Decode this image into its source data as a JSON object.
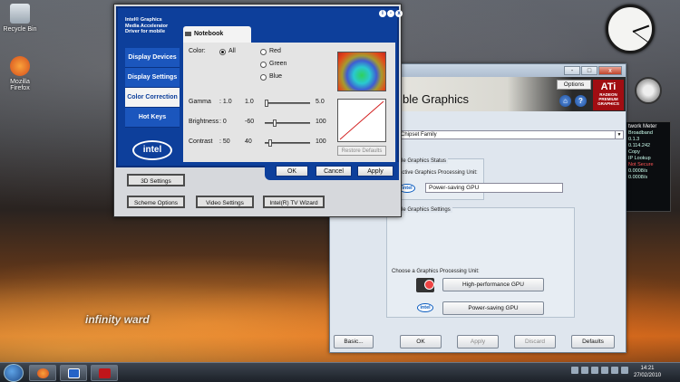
{
  "desktop": {
    "icons": [
      {
        "name": "recycle-bin",
        "label": "Recycle Bin"
      },
      {
        "name": "firefox",
        "label": "Mozilla Firefox"
      }
    ],
    "wallpaper_logo": "infinity ward"
  },
  "intel_window": {
    "brand": "Intel® Graphics Media Accelerator Driver for mobile",
    "title_buttons": [
      "i",
      "-",
      "x"
    ],
    "nav": [
      "Display Devices",
      "Display Settings",
      "Color Correction",
      "Hot Keys"
    ],
    "active_nav": "Color Correction",
    "logo": "intel",
    "tab": "Notebook",
    "color_label": "Color:",
    "color_options": [
      "All",
      "Red",
      "Green",
      "Blue"
    ],
    "selected_color": "All",
    "sliders": [
      {
        "label": "Gamma",
        "min": ": 1.0",
        "value": "1.0",
        "max": "5.0",
        "fraction": 0.0
      },
      {
        "label": "Brightness",
        "min": ": 0",
        "value": "-60",
        "max": "100",
        "fraction": 0.2
      },
      {
        "label": "Contrast",
        "min": ": 50",
        "value": "40",
        "max": "100",
        "fraction": 0.1
      }
    ],
    "restore": "Restore Defaults",
    "ok": "OK",
    "cancel": "Cancel",
    "apply": "Apply",
    "extra_buttons": [
      "3D Settings",
      "Scheme Options",
      "Video Settings",
      "Intel(R) TV Wizard"
    ]
  },
  "ati_window": {
    "title_fragment": "ter",
    "window_controls": [
      "-",
      "□",
      "x"
    ],
    "options": "Options",
    "heading": "ble Graphics",
    "logo_main": "ATi",
    "logo_sub": "RADEON PREMIUM GRAPHICS",
    "chipset": "ress Chipset Family",
    "status_group": "itchable Graphics Status",
    "current_label": "rrent active Graphics Processing Unit:",
    "current_gpu": "Power-saving GPU",
    "settings_group": "itchable Graphics Settings",
    "choose_label": "Choose a Graphics Processing Unit:",
    "high_perf": "High-performance GPU",
    "power_saving": "Power-saving GPU",
    "buttons": [
      "Basic...",
      "OK",
      "Apply",
      "Discard",
      "Defaults"
    ]
  },
  "gadgets": {
    "netmeter_title": "twork Meter",
    "netmeter_lines": [
      "Broadband",
      "0.1.3",
      "0.114.242",
      "Copy",
      "IP Lookup",
      "Not Secure",
      "0.0008/s",
      "0.0008/s"
    ]
  },
  "taskbar": {
    "time": "14:21",
    "date": "27/02/2010"
  },
  "colors": {
    "intel_blue": "#0d3f9b",
    "ati_red": "#a10d12"
  }
}
